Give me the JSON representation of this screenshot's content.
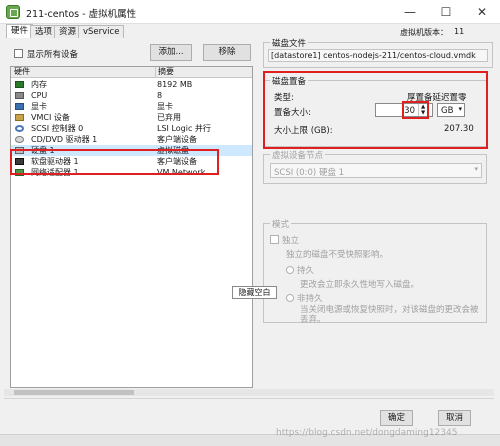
{
  "window": {
    "title": "211-centos - 虚拟机属性",
    "min_glyph": "—",
    "max_glyph": "☐",
    "close_glyph": "✕"
  },
  "tabs": [
    {
      "label": "硬件",
      "active": true
    },
    {
      "label": "选项",
      "active": false
    },
    {
      "label": "资源",
      "active": false
    },
    {
      "label": "vService",
      "active": false
    }
  ],
  "version": {
    "label": "虚拟机版本：",
    "value": "11"
  },
  "toolbar": {
    "show_all_label": "显示所有设备",
    "add_label": "添加...",
    "remove_label": "移除"
  },
  "hardware": {
    "col_hw": "硬件",
    "col_summary": "摘要",
    "rows": [
      {
        "name": "内存",
        "summary": "8192 MB",
        "icon": "memory-icon"
      },
      {
        "name": "CPU",
        "summary": "8",
        "icon": "cpu-icon"
      },
      {
        "name": "显卡",
        "summary": "显卡",
        "icon": "video-card-icon"
      },
      {
        "name": "VMCI 设备",
        "summary": "已弃用",
        "icon": "vmci-device-icon"
      },
      {
        "name": "SCSI 控制器 0",
        "summary": "LSI Logic 并行",
        "icon": "scsi-controller-icon"
      },
      {
        "name": "CD/DVD 驱动器 1",
        "summary": "客户端设备",
        "icon": "cd-dvd-icon"
      },
      {
        "name": "硬盘 1",
        "summary": "虚拟磁盘",
        "icon": "hard-disk-icon",
        "selected": true
      },
      {
        "name": "软盘驱动器 1",
        "summary": "客户端设备",
        "icon": "floppy-icon"
      },
      {
        "name": "网络适配器 1",
        "summary": "VM Network",
        "icon": "network-adapter-icon"
      }
    ]
  },
  "disk_file": {
    "title": "磁盘文件",
    "value": "[datastore1] centos-nodejs-211/centos-cloud.vmdk"
  },
  "provisioning": {
    "title": "磁盘置备",
    "type_label": "类型:",
    "type_value": "厚置备延迟置零",
    "size_label": "置备大小:",
    "size_value": "30",
    "unit_value": "GB",
    "max_label": "大小上限 (GB):",
    "max_value": "207.30",
    "spin_up": "▲",
    "spin_down": "▼",
    "dropdown_arrow": "▾"
  },
  "virtual_device_node": {
    "title": "虚拟设备节点",
    "value": "SCSI (0:0) 硬盘 1",
    "dropdown_arrow": "▾"
  },
  "mode": {
    "title": "模式",
    "independent_label": "独立",
    "independent_desc": "独立的磁盘不受快照影响。",
    "persistent_label": "持久",
    "persistent_desc": "更改会立即永久性地写入磁盘。",
    "nonpersistent_label": "非持久",
    "nonpersistent_desc": "当关闭电源或恢复快照时，对该磁盘的更改会被丢弃。"
  },
  "tooltip": "隐藏空白",
  "footer": {
    "ok_label": "确定",
    "cancel_label": "取消"
  },
  "watermark": "https://blog.csdn.net/dongdaming12345",
  "colors": {
    "highlight_box": "#e02020",
    "selected_row": "#cde8ff"
  }
}
